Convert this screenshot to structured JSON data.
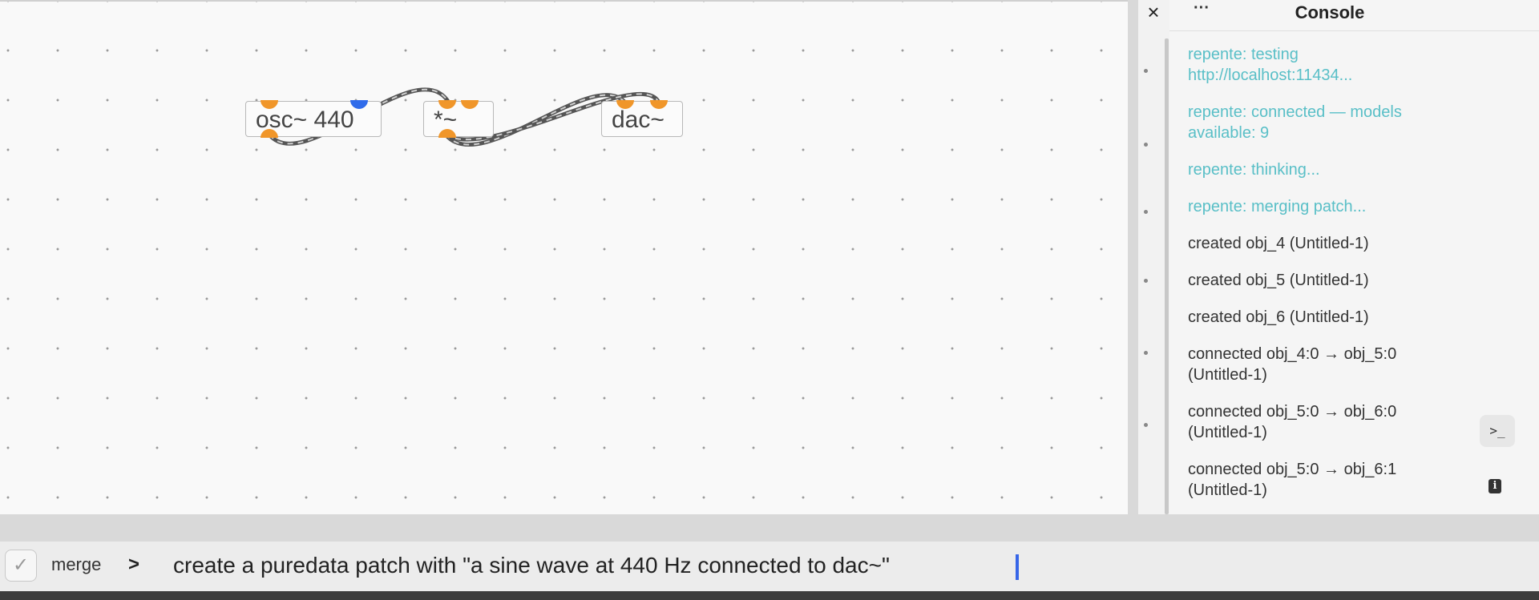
{
  "canvas": {
    "objects": [
      {
        "id": "osc",
        "label": "osc~ 440"
      },
      {
        "id": "mul",
        "label": "*~"
      },
      {
        "id": "dac",
        "label": "dac~"
      }
    ]
  },
  "console": {
    "title": "Console",
    "close_icon": "×",
    "more_icon": "···",
    "lines": [
      {
        "text": "repente: testing http://localhost:11434...",
        "kind": "info"
      },
      {
        "text": "repente: connected — models available: 9",
        "kind": "info"
      },
      {
        "text": "repente: thinking...",
        "kind": "info"
      },
      {
        "text": "repente: merging patch...",
        "kind": "info"
      },
      {
        "text": "created obj_4 (Untitled-1)",
        "kind": "log"
      },
      {
        "text": "created obj_5 (Untitled-1)",
        "kind": "log"
      },
      {
        "text": "created obj_6 (Untitled-1)",
        "kind": "log"
      },
      {
        "text": "connected obj_4:0 → obj_5:0 (Untitled-1)",
        "kind": "log"
      },
      {
        "text": "connected obj_5:0 → obj_6:0 (Untitled-1)",
        "kind": "log"
      },
      {
        "text": "connected obj_5:0 → obj_6:1 (Untitled-1)",
        "kind": "log"
      }
    ],
    "terminal_icon": ">_",
    "info_icon": "i"
  },
  "cmdbar": {
    "merge_label": "merge",
    "merge_checked": true,
    "prompt_symbol": ">",
    "input_value": "create a puredata patch with \"a sine wave at 440 Hz connected to dac~\""
  },
  "colors": {
    "signal_port": "#f0962a",
    "control_port": "#2f6bea",
    "console_info": "#59bfc7",
    "caret": "#3766e8"
  }
}
